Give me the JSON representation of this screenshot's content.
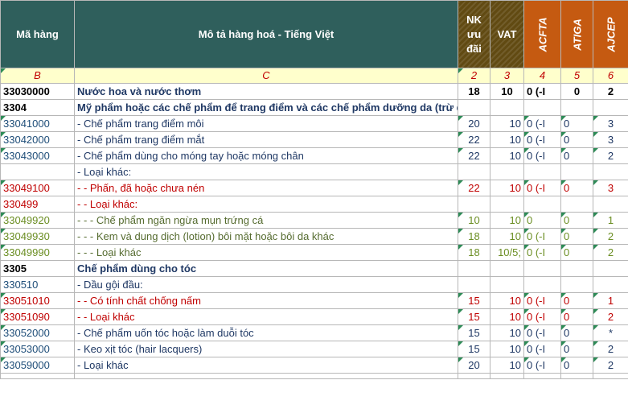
{
  "header": {
    "ma_hang": "Mã hàng",
    "mo_ta": "Mô tả hàng hoá - Tiếng Việt",
    "nk_uu_dai": [
      "NK",
      "ưu",
      "đãi"
    ],
    "vat": "VAT",
    "acfta": "ACFTA",
    "atiga": "ATIGA",
    "ajcep": "AJCEP"
  },
  "index_row": [
    "B",
    "C",
    "2",
    "3",
    "4",
    "5",
    "6"
  ],
  "rows": [
    {
      "code": "33030000",
      "desc": "Nước hoa và nước thơm",
      "nk": "18",
      "vat": "10",
      "acfta": "0 (-I",
      "atiga": "0",
      "ajcep": "2"
    },
    {
      "code": "3304",
      "desc": "Mỹ phẩm hoặc các chế phẩm để trang điểm và các chế phẩm dưỡng da (trừ dược phẩm), kể cả các chế phẩm chống nắng hoặc bắt nắng; các chế phẩm dùng cho móng tay hoặc móng chân",
      "nk": "",
      "vat": "",
      "acfta": "",
      "atiga": "",
      "ajcep": ""
    },
    {
      "code": "33041000",
      "desc": "- Chế phẩm trang điểm môi",
      "nk": "20",
      "vat": "10",
      "acfta": "0 (-I",
      "atiga": "0",
      "ajcep": "3"
    },
    {
      "code": "33042000",
      "desc": "- Chế phẩm trang điểm mắt",
      "nk": "22",
      "vat": "10",
      "acfta": "0 (-I",
      "atiga": "0",
      "ajcep": "3"
    },
    {
      "code": "33043000",
      "desc": "- Chế phẩm dùng cho móng tay hoặc móng chân",
      "nk": "22",
      "vat": "10",
      "acfta": "0 (-I",
      "atiga": "0",
      "ajcep": "2"
    },
    {
      "code": "",
      "desc": "- Loại khác:",
      "nk": "",
      "vat": "",
      "acfta": "",
      "atiga": "",
      "ajcep": ""
    },
    {
      "code": "33049100",
      "desc": "- - Phấn, đã hoặc chưa nén",
      "nk": "22",
      "vat": "10",
      "acfta": "0 (-I",
      "atiga": "0",
      "ajcep": "3"
    },
    {
      "code": "330499",
      "desc": "- - Loại khác:",
      "nk": "",
      "vat": "",
      "acfta": "",
      "atiga": "",
      "ajcep": ""
    },
    {
      "code": "33049920",
      "desc": "- - - Chế phẩm ngăn ngừa mụn trứng cá",
      "nk": "10",
      "vat": "10",
      "acfta": "0",
      "atiga": "0",
      "ajcep": "1"
    },
    {
      "code": "33049930",
      "desc": "- - - Kem và dung dịch (lotion) bôi mặt hoặc bôi da khác",
      "nk": "18",
      "vat": "10",
      "acfta": "0 (-I",
      "atiga": "0",
      "ajcep": "2"
    },
    {
      "code": "33049990",
      "desc": "- - - Loại khác",
      "nk": "18",
      "vat": "10/5;",
      "acfta": "0 (-I",
      "atiga": "0",
      "ajcep": "2"
    },
    {
      "code": "3305",
      "desc": "Chế phẩm dùng cho tóc",
      "nk": "",
      "vat": "",
      "acfta": "",
      "atiga": "",
      "ajcep": ""
    },
    {
      "code": "330510",
      "desc": "- Dầu gội đầu:",
      "nk": "",
      "vat": "",
      "acfta": "",
      "atiga": "",
      "ajcep": ""
    },
    {
      "code": "33051010",
      "desc": "- - Có tính chất chống nấm",
      "nk": "15",
      "vat": "10",
      "acfta": "0 (-I",
      "atiga": "0",
      "ajcep": "1"
    },
    {
      "code": "33051090",
      "desc": "- - Loại khác",
      "nk": "15",
      "vat": "10",
      "acfta": "0 (-I",
      "atiga": "0",
      "ajcep": "2"
    },
    {
      "code": "33052000",
      "desc": "- Chế phẩm uốn tóc hoặc làm duỗi tóc",
      "nk": "15",
      "vat": "10",
      "acfta": "0 (-I",
      "atiga": "0",
      "ajcep": "*"
    },
    {
      "code": "33053000",
      "desc": "- Keo xịt tóc (hair lacquers)",
      "nk": "15",
      "vat": "10",
      "acfta": "0 (-I",
      "atiga": "0",
      "ajcep": "2"
    },
    {
      "code": "33059000",
      "desc": "- Loại khác",
      "nk": "20",
      "vat": "10",
      "acfta": "0 (-I",
      "atiga": "0",
      "ajcep": "2"
    }
  ],
  "colors": {
    "header_teal": "#2f5f5c",
    "header_brown": "#614a12",
    "header_orange": "#c55a11",
    "index_bg": "#ffffcc",
    "red_text": "#c00000",
    "olive_text": "#6b8e23",
    "blue_text": "#1f3864",
    "comment_marker": "#2e8b57"
  }
}
